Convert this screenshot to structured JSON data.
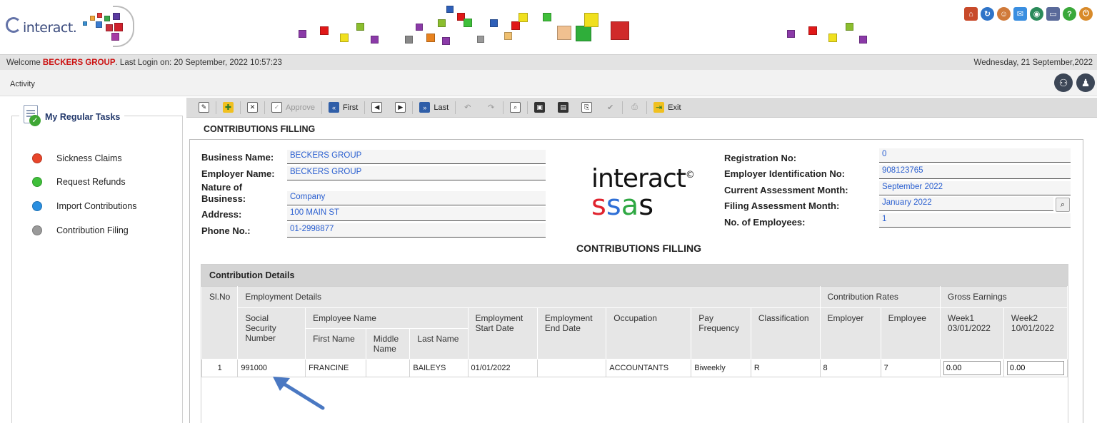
{
  "header": {
    "logo_text": "interact.",
    "icons": [
      "home-icon",
      "refresh-icon",
      "user-icon",
      "mail-icon",
      "globe-icon",
      "monitor-icon",
      "help-icon",
      "logout-icon"
    ]
  },
  "welcome": {
    "prefix": "Welcome ",
    "user": "BECKERS GROUP",
    "last_login": ". Last Login on: 20 September, 2022 10:57:23",
    "date": "Wednesday, 21 September,2022"
  },
  "activity": {
    "label": "Activity"
  },
  "sidebar": {
    "title": "My Regular Tasks",
    "items": [
      {
        "label": "Sickness Claims",
        "color": "#e8452a"
      },
      {
        "label": "Request Refunds",
        "color": "#3fbf3a"
      },
      {
        "label": "Import Contributions",
        "color": "#2a8fe0"
      },
      {
        "label": "Contribution Filing",
        "color": "#9a9a9a"
      }
    ]
  },
  "toolbar": {
    "approve": "Approve",
    "first": "First",
    "last": "Last",
    "exit": "Exit"
  },
  "page": {
    "title": "CONTRIBUTIONS FILLING",
    "center_title": "CONTRIBUTIONS FILLING"
  },
  "brand": {
    "line1": "interact",
    "copyright": "©",
    "line2": [
      "s",
      "s",
      "a",
      "s"
    ],
    "colors": [
      "#e0232e",
      "#2e6fd6",
      "#2fa843",
      "#111111"
    ]
  },
  "form_left": {
    "business_name_label": "Business Name:",
    "business_name": "BECKERS GROUP",
    "employer_name_label": "Employer Name:",
    "employer_name": "BECKERS GROUP",
    "nature_label_1": "Nature of",
    "nature_label_2": "Business:",
    "nature": "Company",
    "address_label": "Address:",
    "address": "100 MAIN ST",
    "phone_label": "Phone No.:",
    "phone": "01-2998877"
  },
  "form_right": {
    "registration_label": "Registration No:",
    "registration": "0",
    "employer_id_label": "Employer Identification No:",
    "employer_id": "908123765",
    "current_month_label": "Current Assessment Month:",
    "current_month": "September 2022",
    "filing_month_label": "Filing Assessment Month:",
    "filing_month": "January 2022",
    "employees_label": "No. of Employees:",
    "employees": "1"
  },
  "details": {
    "title": "Contribution Details",
    "headers": {
      "slno": "Sl.No",
      "employment_details": "Employment Details",
      "contribution_rates": "Contribution Rates",
      "gross_earnings": "Gross Earnings",
      "ssn": "Social Security Number",
      "employee_name": "Employee Name",
      "first_name": "First Name",
      "middle_name": "Middle Name",
      "last_name": "Last Name",
      "start_date": "Employment Start Date",
      "end_date": "Employment End Date",
      "occupation": "Occupation",
      "pay_frequency": "Pay Frequency",
      "classification": "Classification",
      "employer": "Employer",
      "employee": "Employee",
      "week1": "Week1 03/01/2022",
      "week2": "Week2 10/01/2022"
    },
    "rows": [
      {
        "slno": "1",
        "ssn": "991000",
        "first_name": "FRANCINE",
        "middle_name": "",
        "last_name": "BAILEYS",
        "start_date": "01/01/2022",
        "end_date": "",
        "occupation": "ACCOUNTANTS",
        "pay_frequency": "Biweekly",
        "classification": "R",
        "employer_rate": "8",
        "employee_rate": "7",
        "week1": "0.00",
        "week2": "0.00"
      }
    ]
  }
}
